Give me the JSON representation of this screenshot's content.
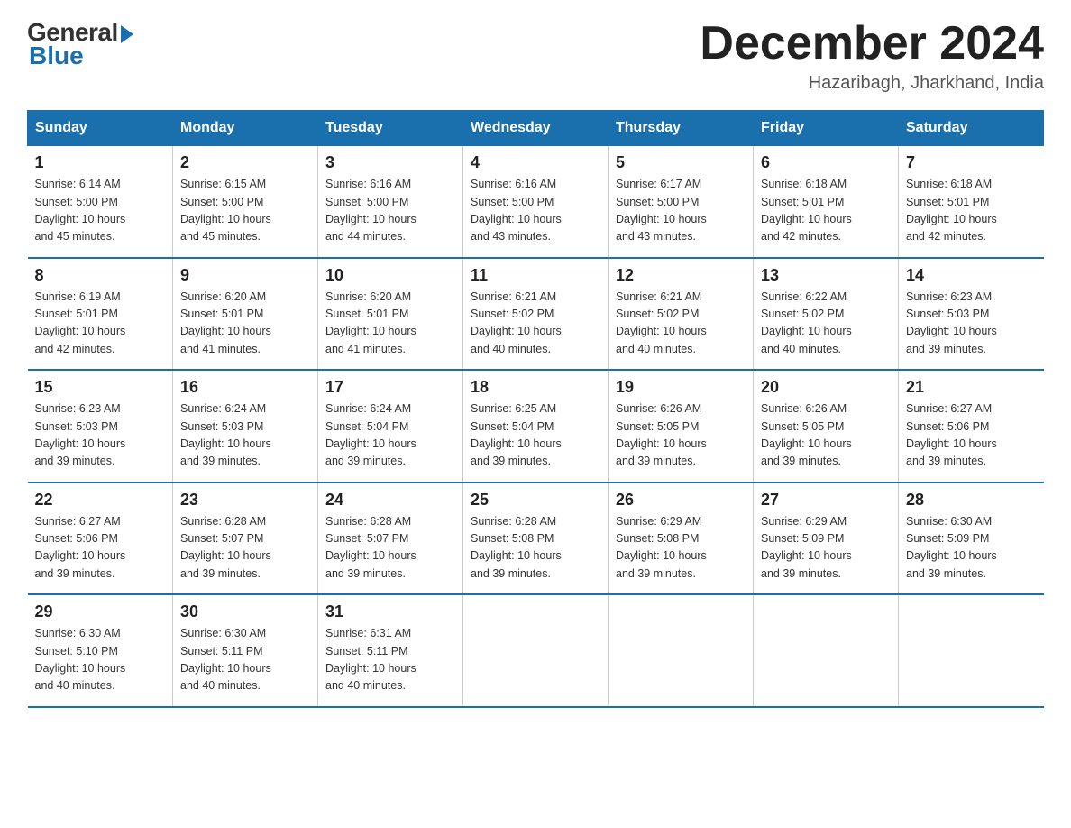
{
  "logo": {
    "general": "General",
    "blue": "Blue"
  },
  "title": "December 2024",
  "location": "Hazaribagh, Jharkhand, India",
  "days_of_week": [
    "Sunday",
    "Monday",
    "Tuesday",
    "Wednesday",
    "Thursday",
    "Friday",
    "Saturday"
  ],
  "weeks": [
    [
      {
        "day": "1",
        "info": "Sunrise: 6:14 AM\nSunset: 5:00 PM\nDaylight: 10 hours\nand 45 minutes."
      },
      {
        "day": "2",
        "info": "Sunrise: 6:15 AM\nSunset: 5:00 PM\nDaylight: 10 hours\nand 45 minutes."
      },
      {
        "day": "3",
        "info": "Sunrise: 6:16 AM\nSunset: 5:00 PM\nDaylight: 10 hours\nand 44 minutes."
      },
      {
        "day": "4",
        "info": "Sunrise: 6:16 AM\nSunset: 5:00 PM\nDaylight: 10 hours\nand 43 minutes."
      },
      {
        "day": "5",
        "info": "Sunrise: 6:17 AM\nSunset: 5:00 PM\nDaylight: 10 hours\nand 43 minutes."
      },
      {
        "day": "6",
        "info": "Sunrise: 6:18 AM\nSunset: 5:01 PM\nDaylight: 10 hours\nand 42 minutes."
      },
      {
        "day": "7",
        "info": "Sunrise: 6:18 AM\nSunset: 5:01 PM\nDaylight: 10 hours\nand 42 minutes."
      }
    ],
    [
      {
        "day": "8",
        "info": "Sunrise: 6:19 AM\nSunset: 5:01 PM\nDaylight: 10 hours\nand 42 minutes."
      },
      {
        "day": "9",
        "info": "Sunrise: 6:20 AM\nSunset: 5:01 PM\nDaylight: 10 hours\nand 41 minutes."
      },
      {
        "day": "10",
        "info": "Sunrise: 6:20 AM\nSunset: 5:01 PM\nDaylight: 10 hours\nand 41 minutes."
      },
      {
        "day": "11",
        "info": "Sunrise: 6:21 AM\nSunset: 5:02 PM\nDaylight: 10 hours\nand 40 minutes."
      },
      {
        "day": "12",
        "info": "Sunrise: 6:21 AM\nSunset: 5:02 PM\nDaylight: 10 hours\nand 40 minutes."
      },
      {
        "day": "13",
        "info": "Sunrise: 6:22 AM\nSunset: 5:02 PM\nDaylight: 10 hours\nand 40 minutes."
      },
      {
        "day": "14",
        "info": "Sunrise: 6:23 AM\nSunset: 5:03 PM\nDaylight: 10 hours\nand 39 minutes."
      }
    ],
    [
      {
        "day": "15",
        "info": "Sunrise: 6:23 AM\nSunset: 5:03 PM\nDaylight: 10 hours\nand 39 minutes."
      },
      {
        "day": "16",
        "info": "Sunrise: 6:24 AM\nSunset: 5:03 PM\nDaylight: 10 hours\nand 39 minutes."
      },
      {
        "day": "17",
        "info": "Sunrise: 6:24 AM\nSunset: 5:04 PM\nDaylight: 10 hours\nand 39 minutes."
      },
      {
        "day": "18",
        "info": "Sunrise: 6:25 AM\nSunset: 5:04 PM\nDaylight: 10 hours\nand 39 minutes."
      },
      {
        "day": "19",
        "info": "Sunrise: 6:26 AM\nSunset: 5:05 PM\nDaylight: 10 hours\nand 39 minutes."
      },
      {
        "day": "20",
        "info": "Sunrise: 6:26 AM\nSunset: 5:05 PM\nDaylight: 10 hours\nand 39 minutes."
      },
      {
        "day": "21",
        "info": "Sunrise: 6:27 AM\nSunset: 5:06 PM\nDaylight: 10 hours\nand 39 minutes."
      }
    ],
    [
      {
        "day": "22",
        "info": "Sunrise: 6:27 AM\nSunset: 5:06 PM\nDaylight: 10 hours\nand 39 minutes."
      },
      {
        "day": "23",
        "info": "Sunrise: 6:28 AM\nSunset: 5:07 PM\nDaylight: 10 hours\nand 39 minutes."
      },
      {
        "day": "24",
        "info": "Sunrise: 6:28 AM\nSunset: 5:07 PM\nDaylight: 10 hours\nand 39 minutes."
      },
      {
        "day": "25",
        "info": "Sunrise: 6:28 AM\nSunset: 5:08 PM\nDaylight: 10 hours\nand 39 minutes."
      },
      {
        "day": "26",
        "info": "Sunrise: 6:29 AM\nSunset: 5:08 PM\nDaylight: 10 hours\nand 39 minutes."
      },
      {
        "day": "27",
        "info": "Sunrise: 6:29 AM\nSunset: 5:09 PM\nDaylight: 10 hours\nand 39 minutes."
      },
      {
        "day": "28",
        "info": "Sunrise: 6:30 AM\nSunset: 5:09 PM\nDaylight: 10 hours\nand 39 minutes."
      }
    ],
    [
      {
        "day": "29",
        "info": "Sunrise: 6:30 AM\nSunset: 5:10 PM\nDaylight: 10 hours\nand 40 minutes."
      },
      {
        "day": "30",
        "info": "Sunrise: 6:30 AM\nSunset: 5:11 PM\nDaylight: 10 hours\nand 40 minutes."
      },
      {
        "day": "31",
        "info": "Sunrise: 6:31 AM\nSunset: 5:11 PM\nDaylight: 10 hours\nand 40 minutes."
      },
      {
        "day": "",
        "info": ""
      },
      {
        "day": "",
        "info": ""
      },
      {
        "day": "",
        "info": ""
      },
      {
        "day": "",
        "info": ""
      }
    ]
  ]
}
